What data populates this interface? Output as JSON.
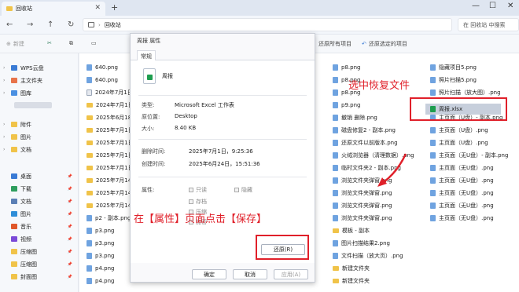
{
  "window": {
    "tab_title": "回收站",
    "new_tab": "+",
    "controls": [
      "—",
      "☐",
      "✕"
    ]
  },
  "address": {
    "nav": [
      "←",
      "→",
      "↑",
      "↻"
    ],
    "path": [
      "回收站"
    ],
    "search_placeholder": "在 回收站 中搜索"
  },
  "toolbar": {
    "new_label": "新建",
    "restore_all": "还原所有项目",
    "restore_selected": "还原选定的项目"
  },
  "sidebar": {
    "items": [
      {
        "label": "WPS云盘",
        "color": "#3a7bd5"
      },
      {
        "label": "主文件夹",
        "color": "#e8734a"
      },
      {
        "label": "图库",
        "color": "#4a90e2"
      },
      {
        "label": "附件",
        "color": "#f0c349"
      },
      {
        "label": "图片",
        "color": "#f0c349"
      },
      {
        "label": "文档",
        "color": "#f0c349"
      },
      {
        "label": "桌面",
        "color": "#3a7bd5"
      },
      {
        "label": "下载",
        "color": "#2f9e5e"
      },
      {
        "label": "文档",
        "color": "#5b7fb5"
      },
      {
        "label": "图片",
        "color": "#2f8ed8"
      },
      {
        "label": "音乐",
        "color": "#e0572a"
      },
      {
        "label": "视频",
        "color": "#7b4ad8"
      },
      {
        "label": "压缩图",
        "color": "#f0c349"
      },
      {
        "label": "压缩图",
        "color": "#f0c349"
      },
      {
        "label": "封面图",
        "color": "#f0c349"
      }
    ]
  },
  "files": {
    "col1": [
      {
        "name": "640.png",
        "type": "img"
      },
      {
        "name": "640.png",
        "type": "img"
      },
      {
        "name": "2024年7月1日-...",
        "type": "doc"
      },
      {
        "name": "2024年7月1日-...",
        "type": "folder"
      },
      {
        "name": "2025年6月18...",
        "type": "folder"
      },
      {
        "name": "2025年7月1日-...",
        "type": "folder"
      },
      {
        "name": "2025年7月1日-...",
        "type": "folder"
      },
      {
        "name": "2025年7月1日-...",
        "type": "folder"
      },
      {
        "name": "2025年7月1日-...",
        "type": "folder"
      },
      {
        "name": "2025年7月14...",
        "type": "folder"
      },
      {
        "name": "2025年7月14...",
        "type": "folder"
      },
      {
        "name": "2025年7月14...",
        "type": "folder"
      },
      {
        "name": "p2 - 副本.png",
        "type": "img"
      },
      {
        "name": "p3.png",
        "type": "img"
      },
      {
        "name": "p3.png",
        "type": "img"
      },
      {
        "name": "p3.png",
        "type": "img"
      },
      {
        "name": "p4.png",
        "type": "img"
      },
      {
        "name": "p4.png",
        "type": "img"
      }
    ],
    "col2": [
      {
        "name": "p8.png",
        "type": "img"
      },
      {
        "name": "p8.png",
        "type": "img"
      },
      {
        "name": "p8.png",
        "type": "img"
      },
      {
        "name": "p9.png",
        "type": "img"
      },
      {
        "name": "撤销 删除.png",
        "type": "img"
      },
      {
        "name": "磁盘修复2 - 副本.png",
        "type": "img"
      },
      {
        "name": "还原文件以前版本.png",
        "type": "img"
      },
      {
        "name": "火绒浏览器（清理数据）.png",
        "type": "img"
      },
      {
        "name": "临时文件夹2 - 副本.png",
        "type": "img"
      },
      {
        "name": "浏览文件夹弹窗.png",
        "type": "img"
      },
      {
        "name": "浏览文件夹弹窗.png",
        "type": "img"
      },
      {
        "name": "浏览文件夹弹窗.png",
        "type": "img"
      },
      {
        "name": "浏览文件夹弹窗.png",
        "type": "img"
      },
      {
        "name": "模板 - 副本",
        "type": "folder"
      },
      {
        "name": "图片扫描结果2.png",
        "type": "img"
      },
      {
        "name": "文件扫描（放大页）.png",
        "type": "img"
      },
      {
        "name": "新建文件夹",
        "type": "folder"
      },
      {
        "name": "新建文件夹",
        "type": "folder"
      }
    ],
    "col3": [
      {
        "name": "隐藏项目5.png",
        "type": "img"
      },
      {
        "name": "照片扫描5.png",
        "type": "img"
      },
      {
        "name": "照片扫描（放大图）.png",
        "type": "img"
      },
      {
        "name": "周报.xlsx",
        "type": "xlsx"
      },
      {
        "name": "主页面（U盘）- 副本.png",
        "type": "img"
      },
      {
        "name": "主页面（U盘）.png",
        "type": "img"
      },
      {
        "name": "主页面（U盘）.png",
        "type": "img"
      },
      {
        "name": "主页面（无U盘）- 副本.png",
        "type": "img"
      },
      {
        "name": "主页面（无U盘）.png",
        "type": "img"
      },
      {
        "name": "主页面（无U盘）.png",
        "type": "img"
      },
      {
        "name": "主页面（无U盘）.png",
        "type": "img"
      },
      {
        "name": "主页面（无U盘）.png",
        "type": "img"
      },
      {
        "name": "主页面（无U盘）.png",
        "type": "img"
      }
    ]
  },
  "dialog": {
    "title": "周报 属性",
    "tab": "常规",
    "file_name": "周报",
    "type_label": "类型:",
    "type_value": "Microsoft Excel 工作表",
    "location_label": "原位置:",
    "location_value": "Desktop",
    "size_label": "大小:",
    "size_value": "8.40 KB",
    "deleted_label": "删除时间:",
    "deleted_value": "2025年7月1日，9:25:36",
    "created_label": "创建时间:",
    "created_value": "2025年6月24日，15:51:36",
    "attributes_label": "属性:",
    "attr_readonly": "只读",
    "attr_hidden": "隐藏",
    "attr_archive": "存档",
    "attr_compress": "压缩",
    "attr_encrypt": "加密",
    "restore_button": "还原(R)",
    "ok_button": "确定",
    "cancel_button": "取消",
    "apply_button": "应用(A)"
  },
  "annotations": {
    "select_text": "选中恢复文件",
    "properties_text": "在【属性】页面点击【保存】",
    "color": "#e0202a"
  }
}
